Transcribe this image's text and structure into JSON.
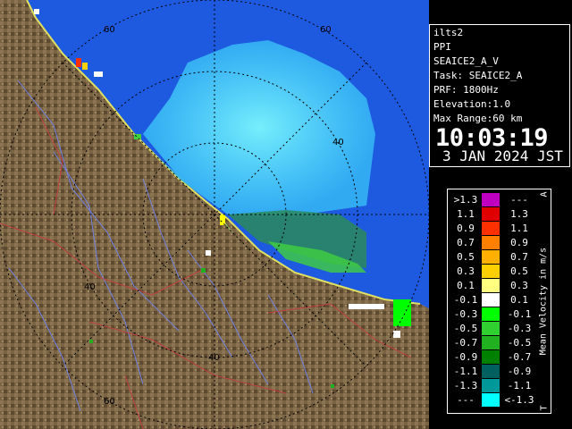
{
  "radar": {
    "range_labels": [
      "60",
      "60",
      "40",
      "40",
      "40",
      "60"
    ]
  },
  "info": {
    "line1": "ilts2",
    "line2": "PPI",
    "line3": "SEAICE2_A_V",
    "line4": "Task: SEAICE2_A",
    "line5": "PRF: 1800Hz",
    "line6": "Elevation:1.0",
    "line7": "Max Range:60 km",
    "time": "10:03:19",
    "date": "3 JAN 2024 JST"
  },
  "legend": {
    "unit": "Mean Velocity in m/s",
    "corner_top": "A",
    "corner_bottom": "T",
    "rows": [
      {
        "lo": ">1.3",
        "hi": "---",
        "color": "#c000c0"
      },
      {
        "lo": "1.1",
        "hi": "1.3",
        "color": "#e00000"
      },
      {
        "lo": "0.9",
        "hi": "1.1",
        "color": "#ff3000"
      },
      {
        "lo": "0.7",
        "hi": "0.9",
        "color": "#ff8000"
      },
      {
        "lo": "0.5",
        "hi": "0.7",
        "color": "#ffb000"
      },
      {
        "lo": "0.3",
        "hi": "0.5",
        "color": "#ffd000"
      },
      {
        "lo": "0.1",
        "hi": "0.3",
        "color": "#ffff80"
      },
      {
        "lo": "-0.1",
        "hi": "0.1",
        "color": "#ffffff"
      },
      {
        "lo": "-0.3",
        "hi": "-0.1",
        "color": "#00ff00"
      },
      {
        "lo": "-0.5",
        "hi": "-0.3",
        "color": "#30d030"
      },
      {
        "lo": "-0.7",
        "hi": "-0.5",
        "color": "#20b020"
      },
      {
        "lo": "-0.9",
        "hi": "-0.7",
        "color": "#008000"
      },
      {
        "lo": "-1.1",
        "hi": "-0.9",
        "color": "#006060"
      },
      {
        "lo": "-1.3",
        "hi": "-1.1",
        "color": "#009898"
      },
      {
        "lo": "---",
        "hi": "<-1.3",
        "color": "#00ffff"
      }
    ]
  },
  "colors": {
    "sea": "#1e5ae0",
    "land": "#7a6444",
    "ring": "#000000"
  }
}
